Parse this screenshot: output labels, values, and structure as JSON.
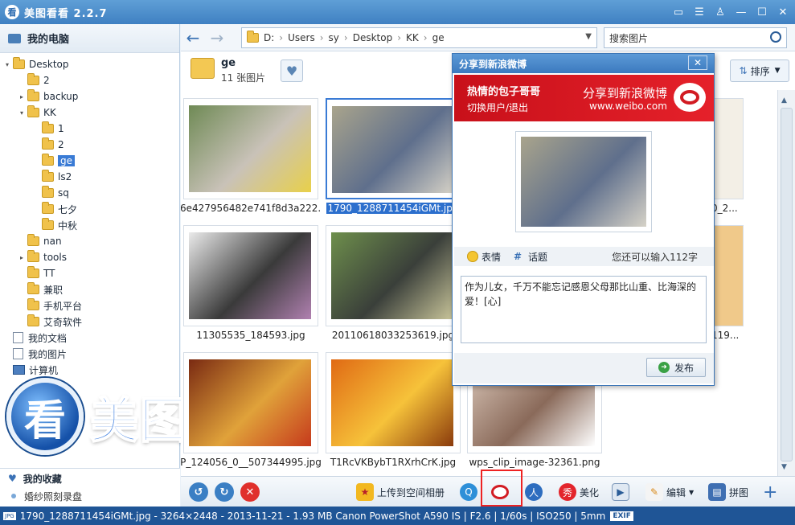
{
  "window": {
    "title": "美图看看 2.2.7",
    "logo_char": "看"
  },
  "sidebar": {
    "heading": "我的电脑",
    "tree": [
      {
        "label": "Desktop",
        "icon": "folder-icon",
        "depth": 0,
        "expander": "▾"
      },
      {
        "label": "2",
        "icon": "folder-icon",
        "depth": 1,
        "expander": ""
      },
      {
        "label": "backup",
        "icon": "folder-icon",
        "depth": 1,
        "expander": "▸"
      },
      {
        "label": "KK",
        "icon": "folder-icon",
        "depth": 1,
        "expander": "▾"
      },
      {
        "label": "1",
        "icon": "folder-icon",
        "depth": 2,
        "expander": ""
      },
      {
        "label": "2",
        "icon": "folder-icon",
        "depth": 2,
        "expander": ""
      },
      {
        "label": "ge",
        "icon": "folder-icon",
        "depth": 2,
        "expander": "",
        "selected": true
      },
      {
        "label": "ls2",
        "icon": "folder-icon",
        "depth": 2,
        "expander": ""
      },
      {
        "label": "sq",
        "icon": "folder-icon",
        "depth": 2,
        "expander": ""
      },
      {
        "label": "七夕",
        "icon": "folder-icon",
        "depth": 2,
        "expander": ""
      },
      {
        "label": "中秋",
        "icon": "folder-icon",
        "depth": 2,
        "expander": ""
      },
      {
        "label": "nan",
        "icon": "folder-icon",
        "depth": 1,
        "expander": ""
      },
      {
        "label": "tools",
        "icon": "folder-icon",
        "depth": 1,
        "expander": "▸"
      },
      {
        "label": "TT",
        "icon": "folder-icon",
        "depth": 1,
        "expander": ""
      },
      {
        "label": "兼职",
        "icon": "folder-icon",
        "depth": 1,
        "expander": ""
      },
      {
        "label": "手机平台",
        "icon": "folder-icon",
        "depth": 1,
        "expander": ""
      },
      {
        "label": "艾奇软件",
        "icon": "folder-icon",
        "depth": 1,
        "expander": ""
      },
      {
        "label": "我的文档",
        "icon": "document-icon",
        "depth": 0,
        "expander": ""
      },
      {
        "label": "我的图片",
        "icon": "document-icon",
        "depth": 0,
        "expander": ""
      },
      {
        "label": "计算机",
        "icon": "computer-icon",
        "depth": 0,
        "expander": ""
      }
    ],
    "favorites_heading": "我的收藏",
    "favorites": [
      "婚纱照刻录盘"
    ]
  },
  "watermark": {
    "circle_char": "看",
    "text": "美图看看"
  },
  "nav": {
    "back": "←",
    "forward": "→",
    "path": [
      "D:",
      "Users",
      "sy",
      "Desktop",
      "KK",
      "ge"
    ],
    "path_sep": "›",
    "search_placeholder": "搜索图片"
  },
  "folder": {
    "name": "ge",
    "count": "11 张图片",
    "sort_label": "排序"
  },
  "thumbnails": [
    {
      "name": "6e427956482e741f8d3a222...",
      "colors": [
        "#6f8a55",
        "#c9c2b8",
        "#e8d04a"
      ]
    },
    {
      "name": "1790_1288711454iGMt.jpg",
      "colors": [
        "#a9a48c",
        "#5f6f8c",
        "#d6d2c7"
      ],
      "selected": true
    },
    {
      "name": "11305535_184593.jpg",
      "colors": [
        "#eaeaea",
        "#3a3a3a",
        "#b080b0"
      ]
    },
    {
      "name": "20110618033253619.jpg",
      "colors": [
        "#6e8f4c",
        "#3a3f3a",
        "#c9c59a"
      ]
    },
    {
      "name": "P_124056_0__507344995.jpg",
      "colors": [
        "#7a2a12",
        "#e0a23a",
        "#c63a1c"
      ]
    },
    {
      "name": "T1RcVKBybT1RXrhCrK.jpg",
      "colors": [
        "#e06a14",
        "#f6c23a",
        "#8a3a0c"
      ]
    },
    {
      "name": "wps_clip_image-32361.png",
      "colors": [
        "#d9c6b8",
        "#8a6a5a",
        "#ffffff"
      ]
    }
  ],
  "partial_labels": [
    "0_2...",
    "119..."
  ],
  "bottom_toolbar": {
    "upload": "上传到空间相册",
    "beautify": "美化",
    "edit": "编辑",
    "puzzle": "拼图"
  },
  "status": "1790_1288711454iGMt.jpg - 3264×2448 - 2013-11-21 - 1.93 MB   Canon PowerShot A590 IS  |  F2.6  |  1/60s  |  ISO250  |  5mm",
  "status_jpg": "JPG",
  "status_exif": "EXIF",
  "dialog": {
    "title": "分享到新浪微博",
    "close": "✕",
    "username": "热情的包子哥哥",
    "switch_user": "切换用户/退出",
    "share_slogan": "分享到新浪微博",
    "url": "www.weibo.com",
    "emotion_label": "表情",
    "topic_label": "话题",
    "remaining": "您还可以输入112字",
    "text": "作为儿女，千万不能忘记感恩父母那比山重、比海深的爱！[心]",
    "post_button": "发布"
  }
}
